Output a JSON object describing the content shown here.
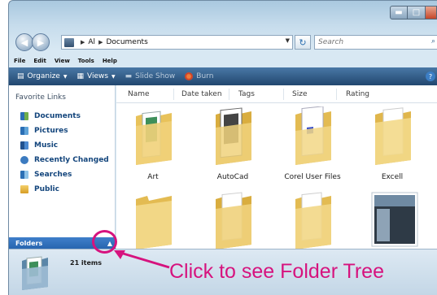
{
  "address": {
    "crumbs": [
      "Al",
      "Documents"
    ],
    "search_placeholder": "Search"
  },
  "menu": [
    "File",
    "Edit",
    "View",
    "Tools",
    "Help"
  ],
  "toolbar": {
    "organize": "Organize",
    "views": "Views",
    "slideshow": "Slide Show",
    "burn": "Burn"
  },
  "nav_pane": {
    "section_title": "Favorite Links",
    "links": [
      {
        "label": "Documents",
        "icon": "documents-icon"
      },
      {
        "label": "Pictures",
        "icon": "pictures-icon"
      },
      {
        "label": "Music",
        "icon": "music-icon"
      },
      {
        "label": "Recently Changed",
        "icon": "recently-changed-icon"
      },
      {
        "label": "Searches",
        "icon": "searches-icon"
      },
      {
        "label": "Public",
        "icon": "public-icon"
      }
    ],
    "folders_label": "Folders"
  },
  "columns": [
    "Name",
    "Date taken",
    "Tags",
    "Size",
    "Rating"
  ],
  "items": [
    {
      "name": "Art",
      "kind": "folder-docs"
    },
    {
      "name": "AutoCad",
      "kind": "folder-autocad"
    },
    {
      "name": "Corel User Files",
      "kind": "folder-corel"
    },
    {
      "name": "Excell",
      "kind": "folder-plain"
    },
    {
      "name": "",
      "kind": "folder-empty"
    },
    {
      "name": "",
      "kind": "folder-pages"
    },
    {
      "name": "",
      "kind": "folder-pages"
    },
    {
      "name": "",
      "kind": "image-thumb"
    }
  ],
  "details": {
    "count": "21 items"
  },
  "annotation": {
    "text": "Click to see Folder Tree",
    "color": "#d6137e"
  }
}
